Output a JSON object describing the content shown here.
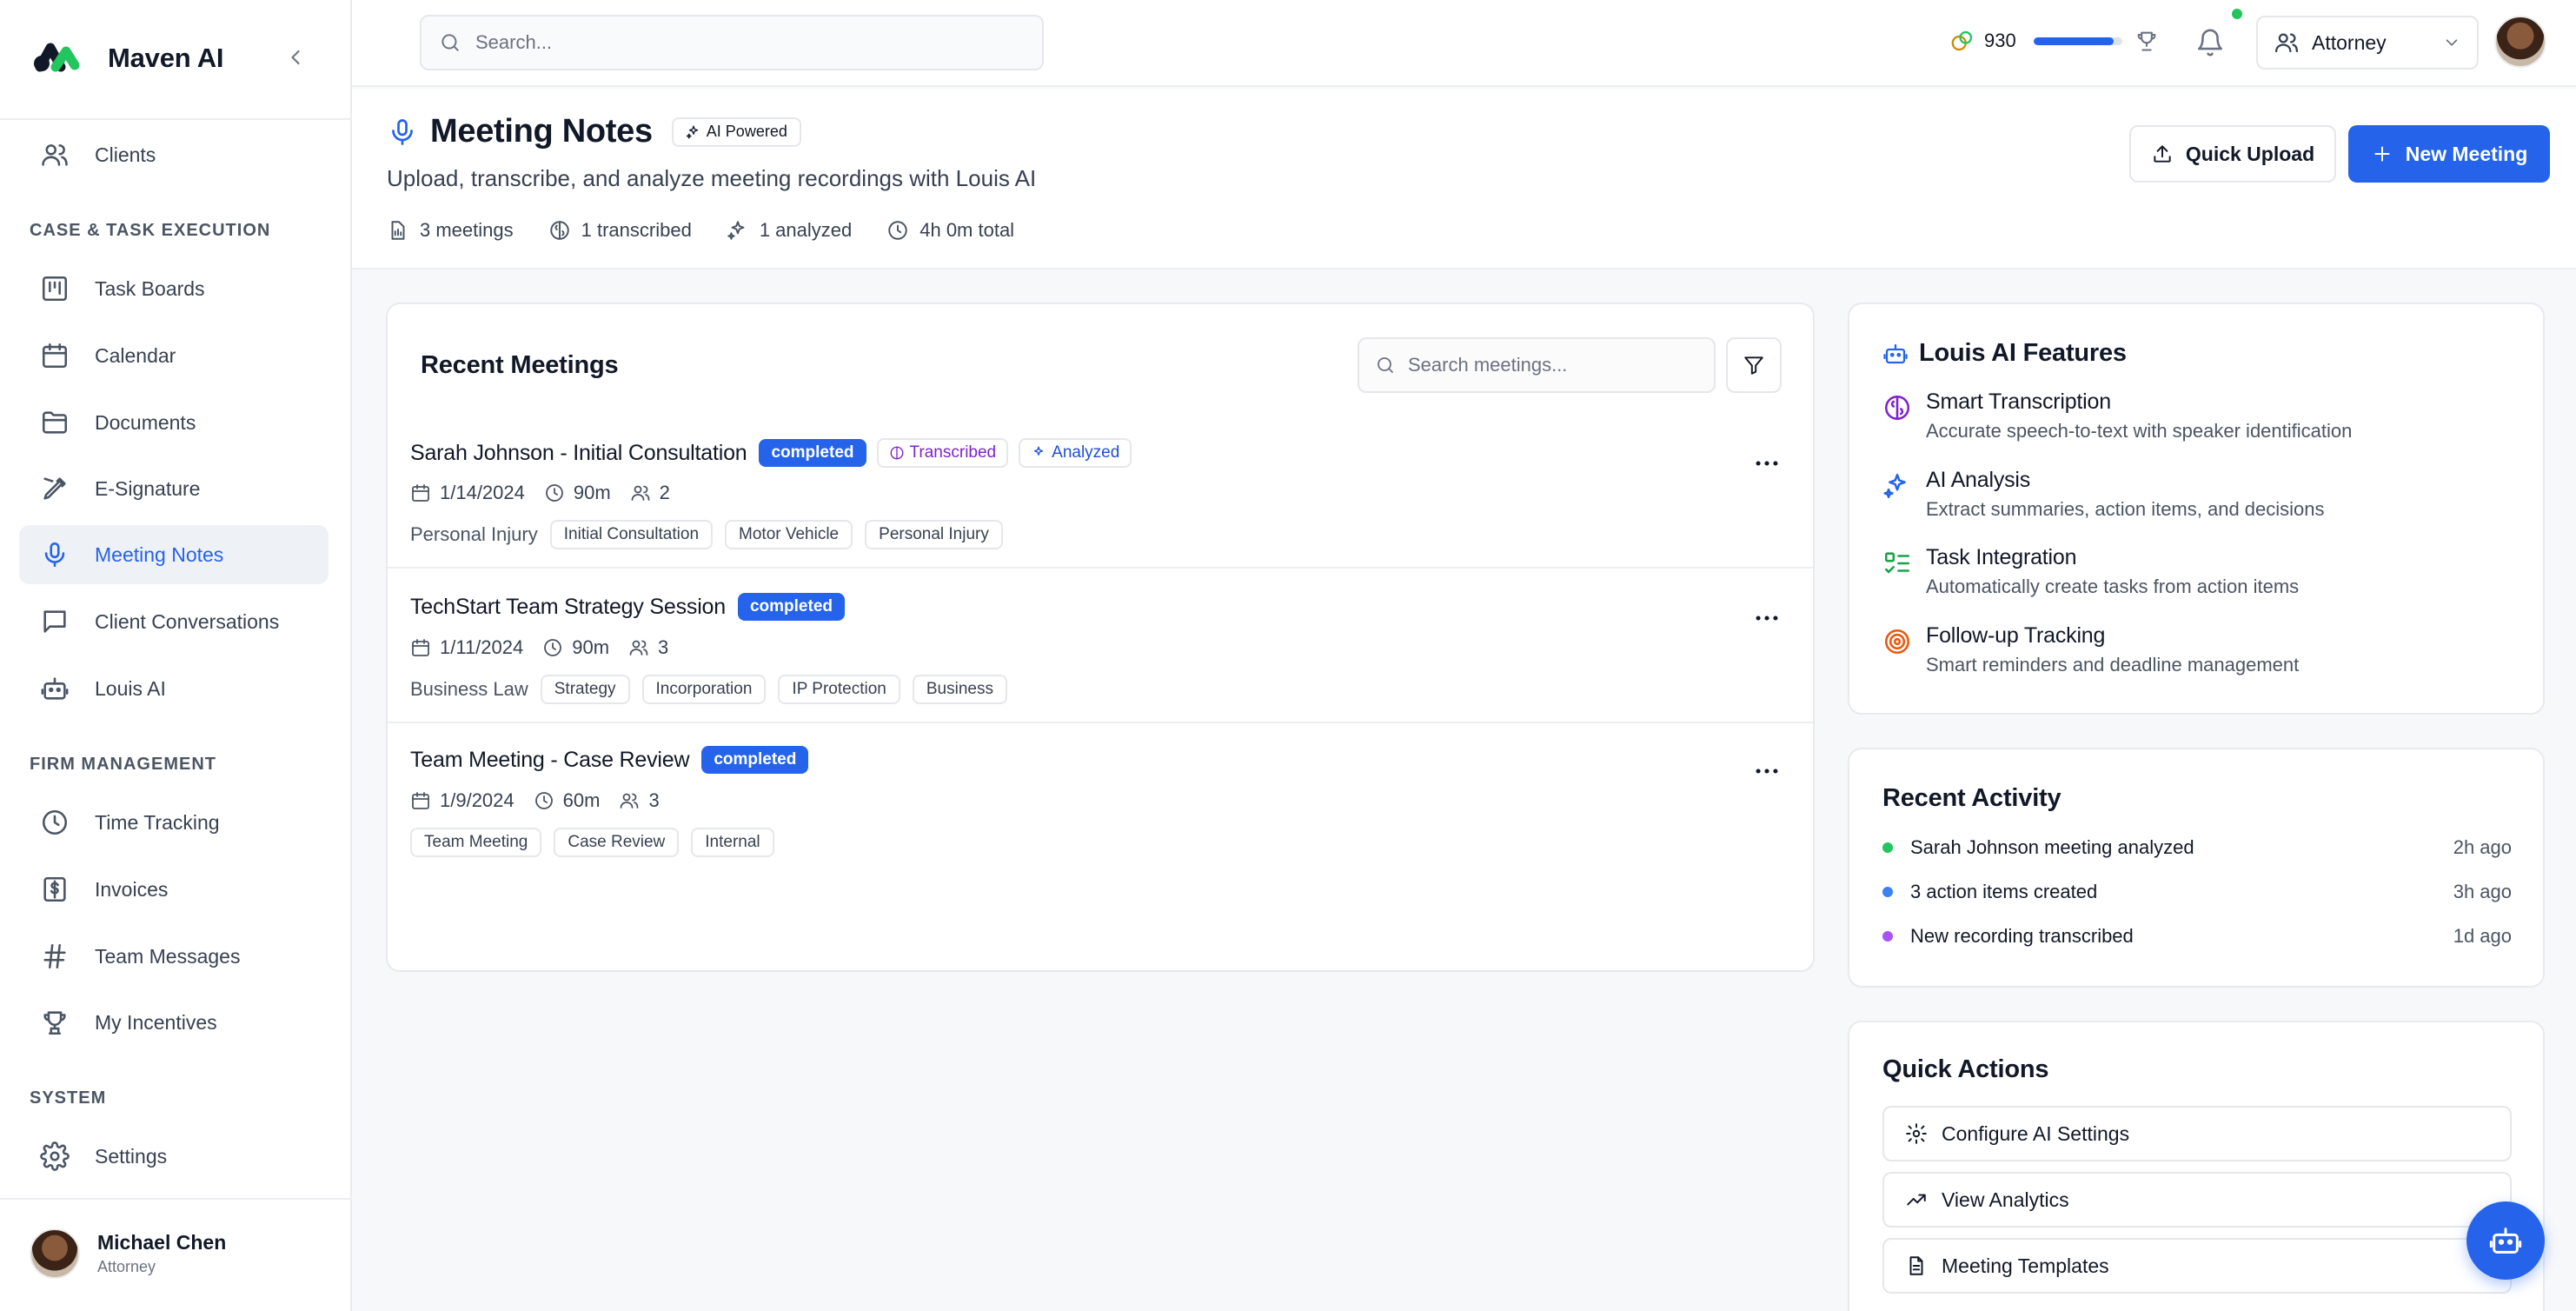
{
  "app": {
    "name": "Maven AI"
  },
  "sidebar": {
    "top_item": {
      "label": "Clients",
      "icon": "users-icon"
    },
    "sections": [
      {
        "title": "CASE & TASK EXECUTION",
        "items": [
          {
            "label": "Task Boards",
            "icon": "kanban-icon"
          },
          {
            "label": "Calendar",
            "icon": "calendar-icon"
          },
          {
            "label": "Documents",
            "icon": "folder-icon"
          },
          {
            "label": "E-Signature",
            "icon": "pen-icon"
          },
          {
            "label": "Meeting Notes",
            "icon": "mic-icon",
            "active": true
          },
          {
            "label": "Client Conversations",
            "icon": "chat-icon"
          },
          {
            "label": "Louis AI",
            "icon": "bot-icon"
          }
        ]
      },
      {
        "title": "FIRM MANAGEMENT",
        "items": [
          {
            "label": "Time Tracking",
            "icon": "clock-icon"
          },
          {
            "label": "Invoices",
            "icon": "dollar-file-icon"
          },
          {
            "label": "Team Messages",
            "icon": "hash-icon"
          },
          {
            "label": "My Incentives",
            "icon": "trophy-icon"
          }
        ]
      },
      {
        "title": "SYSTEM",
        "items": [
          {
            "label": "Settings",
            "icon": "gear-icon"
          }
        ]
      }
    ],
    "user": {
      "name": "Michael Chen",
      "role": "Attorney"
    }
  },
  "topbar": {
    "search_placeholder": "Search...",
    "points": "930",
    "points_progress": 0.9,
    "role_selected": "Attorney"
  },
  "header": {
    "title": "Meeting Notes",
    "badge": "AI Powered",
    "subtitle": "Upload, transcribe, and analyze meeting recordings with Louis AI",
    "stats": [
      "3 meetings",
      "1 transcribed",
      "1 analyzed",
      "4h 0m total"
    ],
    "quick_upload": "Quick Upload",
    "new_meeting": "New Meeting"
  },
  "meetings": {
    "title": "Recent Meetings",
    "search_placeholder": "Search meetings...",
    "items": [
      {
        "title": "Sarah Johnson - Initial Consultation",
        "status": "completed",
        "transcribed": "Transcribed",
        "analyzed": "Analyzed",
        "date": "1/14/2024",
        "duration": "90m",
        "attendees": "2",
        "type": "Personal Injury",
        "tags": [
          "Initial Consultation",
          "Motor Vehicle",
          "Personal Injury"
        ]
      },
      {
        "title": "TechStart Team Strategy Session",
        "status": "completed",
        "date": "1/11/2024",
        "duration": "90m",
        "attendees": "3",
        "type": "Business Law",
        "tags": [
          "Strategy",
          "Incorporation",
          "IP Protection",
          "Business"
        ]
      },
      {
        "title": "Team Meeting - Case Review",
        "status": "completed",
        "date": "1/9/2024",
        "duration": "60m",
        "attendees": "3",
        "type": "",
        "tags": [
          "Team Meeting",
          "Case Review",
          "Internal"
        ]
      }
    ]
  },
  "features": {
    "title": "Louis AI Features",
    "items": [
      {
        "title": "Smart Transcription",
        "desc": "Accurate speech-to-text with speaker identification",
        "icon": "brain-icon",
        "color": "#7e22ce"
      },
      {
        "title": "AI Analysis",
        "desc": "Extract summaries, action items, and decisions",
        "icon": "sparkles-icon",
        "color": "#2563eb"
      },
      {
        "title": "Task Integration",
        "desc": "Automatically create tasks from action items",
        "icon": "checklist-icon",
        "color": "#16a34a"
      },
      {
        "title": "Follow-up Tracking",
        "desc": "Smart reminders and deadline management",
        "icon": "target-icon",
        "color": "#ea580c"
      }
    ]
  },
  "activity": {
    "title": "Recent Activity",
    "items": [
      {
        "text": "Sarah Johnson meeting analyzed",
        "time": "2h ago",
        "color": "#22c55e"
      },
      {
        "text": "3 action items created",
        "time": "3h ago",
        "color": "#3b82f6"
      },
      {
        "text": "New recording transcribed",
        "time": "1d ago",
        "color": "#a855f7"
      }
    ]
  },
  "quick_actions": {
    "title": "Quick Actions",
    "items": [
      {
        "label": "Configure AI Settings",
        "icon": "gear-icon"
      },
      {
        "label": "View Analytics",
        "icon": "trend-icon"
      },
      {
        "label": "Meeting Templates",
        "icon": "document-icon"
      }
    ]
  }
}
